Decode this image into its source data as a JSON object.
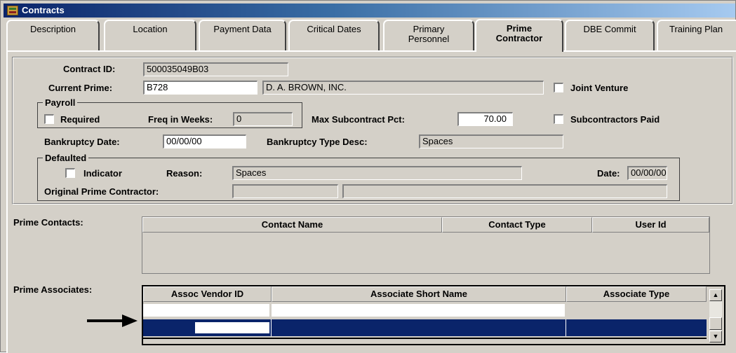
{
  "window": {
    "title": "Contracts"
  },
  "tabs": [
    {
      "label": "Description"
    },
    {
      "label": "Location"
    },
    {
      "label": "Payment Data"
    },
    {
      "label": "Critical Dates"
    },
    {
      "line1": "Primary",
      "line2": "Personnel"
    },
    {
      "line1": "Prime",
      "line2": "Contractor",
      "active": true
    },
    {
      "label": "DBE Commit"
    },
    {
      "label": "Training Plan"
    }
  ],
  "form": {
    "contract_id_label": "Contract ID:",
    "contract_id": "500035049B03",
    "current_prime_label": "Current Prime:",
    "current_prime_code": "B728",
    "current_prime_name": "D. A. BROWN, INC.",
    "joint_venture_label": "Joint Venture",
    "payroll_legend": "Payroll",
    "required_label": "Required",
    "freq_label": "Freq in Weeks:",
    "freq_value": "0",
    "max_sub_label": "Max Subcontract Pct:",
    "max_sub_value": "70.00",
    "subs_paid_label": "Subcontractors Paid",
    "bankruptcy_date_label": "Bankruptcy Date:",
    "bankruptcy_date": "00/00/00",
    "bankruptcy_type_label": "Bankruptcy Type Desc:",
    "bankruptcy_type": "Spaces",
    "defaulted_legend": "Defaulted",
    "indicator_label": "Indicator",
    "reason_label": "Reason:",
    "reason_value": "Spaces",
    "date_label": "Date:",
    "date_value": "00/00/00",
    "original_prime_label": "Original Prime Contractor:",
    "original_prime_code": "",
    "original_prime_name": ""
  },
  "prime_contacts": {
    "label": "Prime Contacts:",
    "columns": [
      "Contact Name",
      "Contact Type",
      "User Id"
    ]
  },
  "prime_associates": {
    "label": "Prime Associates:",
    "columns": [
      "Assoc Vendor ID",
      "Associate Short Name",
      "Associate Type"
    ]
  },
  "icons": [
    "app-icon",
    "arrow-right-icon",
    "scroll-up-icon",
    "scroll-down-icon"
  ],
  "colors": {
    "selection": "#0a246a",
    "face": "#d4d0c8",
    "title_start": "#0a246a"
  }
}
